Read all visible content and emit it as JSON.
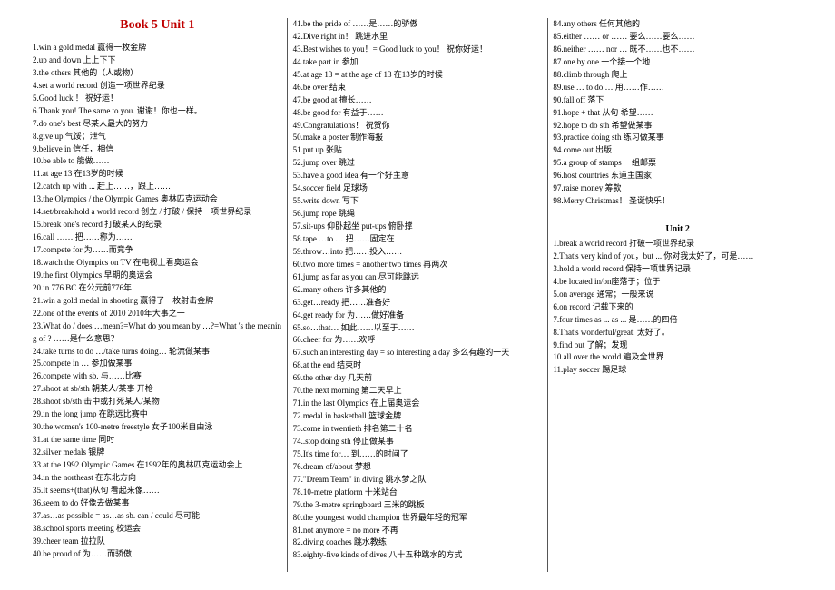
{
  "title": "Book 5   Unit 1",
  "subtitle": "Unit 2",
  "u1": [
    "1.win a gold medal     赢得一枚金牌",
    "2.up and down       上上下下",
    "3.the others             其他的（人或物）",
    "4.set a world record     创造一项世界纪录",
    "5.Good luck ！          祝好运！",
    "6.Thank you! The same to you.  谢谢！你也一样。",
    "7.do one's best       尽某人最大的努力",
    "8.give up         气馁；泄气",
    "9.believe in         信任，相信",
    "10.be able to       能做……",
    "11.at age 13       在13岁的时候",
    "12.catch up with ...    赶上……，跟上……",
    "13.the Olympics / the Olympic Games  奥林匹克运动会",
    "14.set/break/hold a world record 创立 / 打破 / 保持一项世界纪录",
    "15.break one's record 打破某人的纪录",
    "16.call ……  把……称为……",
    "17.compete for   为……而竞争",
    "18.watch the Olympics on TV  在电视上看奥运会",
    "19.the first Olympics  早期的奥运会",
    "20.in 776 BC    在公元前776年",
    "21.win a gold medal in shooting  赢得了一枚射击金牌",
    "22.one of the events of 2010  2010年大事之一",
    "23.What do / does …mean?=What do you mean by …?=What 's the meaning of ?  ……是什么意思？",
    "24.take turns to do …/take turns doing…   轮流做某事",
    "25.compete in …  参加做某事",
    "26.compete with sb.  与……比赛",
    "27.shoot at sb/sth  朝某人/某事 开枪",
    "28.shoot sb/sth  击中或打死某人/某物",
    "29.in the long jump  在跳远比赛中",
    "30.the women's 100-metre freestyle   女子100米自由泳",
    "31.at the same time  同时",
    "32.silver medals 银牌",
    "33.at the 1992 Olympic Games   在1992年的奥林匹克运动会上",
    "34.in the northeast   在东北方向",
    "35.It seems+(that)从句  看起来像……",
    "36.seem to do  好像去做某事",
    "37.as…as possible = as…as sb. can / could  尽可能",
    "38.school sports meeting  校运会",
    "39.cheer team 拉拉队",
    "40.be proud of  为……而骄傲",
    "41.be the pride of   ……是……的骄傲",
    "42.Dive right in！ 跳进水里",
    "43.Best wishes to you！= Good luck to you！ 祝你好运！",
    "44.take part in  参加",
    "45.at age 13 = at the age of 13   在13岁的时候",
    "46.be over  结束",
    "47.be good at   擅长……",
    "48.be good for  有益于……",
    "49.Congratulations！ 祝贺你",
    "50.make a poster 制作海报",
    "51.put up  张贴",
    "52.jump over  跳过",
    "53.have a good idea   有一个好主意",
    "54.soccer field   足球场",
    "55.write down  写下",
    "56.jump rope 跳绳",
    "57.sit-ups 仰卧起坐 put-ups  俯卧撑",
    "58.tape …to …  把……固定在",
    "59.throw…into  把……投入……",
    "60.two more times = another two times   再两次",
    "61.jump as far as you can  尽可能跳远",
    "62.many others 许多其他的",
    "63.get…ready 把……准备好",
    "64.get ready for   为……做好准备",
    "65.so…that…  如此……以至于……",
    "66.cheer for  为……欢呼",
    "67.such an interesting day = so interesting a day  多么有趣的一天",
    "68.at the end   结束时",
    "69.the other day  几天前",
    "70.the next morning   第二天早上",
    "71.in the last Olympics   在上届奥运会",
    "72.medal in basketball   篮球金牌",
    "73.come in twentieth    排名第二十名",
    "74..stop doing sth  停止做某事",
    "75.It's time for…  到……的时间了",
    "76.dream of/about  梦想",
    "77.\"Dream Team\" in diving   跳水梦之队",
    "78.10-metre platform  十米站台",
    "79.the 3-metre springboard    三米的跳板",
    "80.the youngest world champion 世界最年轻的冠军",
    "81.not anymore = no more  不再",
    "82.diving coaches   跳水教练",
    "83.eighty-five kinds of dives    八十五种跳水的方式",
    "84.any others  任何其他的",
    "85.either ……  or ……  要么……要么……",
    "86.neither ……  nor …   既不……也不……",
    "87.one by one  一个接一个地",
    "88.climb through   爬上",
    "89.use … to do …    用……作……",
    "90.fall off   落下",
    "91.hope + that 从句   希望……",
    "92.hope to do sth  希望做某事",
    "93.practice doing sth   练习做某事",
    "94.come out  出版",
    "95.a group of stamps 一组邮票",
    "96.host countries  东道主国家",
    "97.raise money  筹款",
    "98.Merry Christmas！   圣诞快乐！"
  ],
  "u2": [
    "1.break a world record 打破一项世界纪录",
    "2.That's very kind of you，but ... 你对我太好了，可是……",
    "3.hold a world record 保持一项世界记录",
    "4.be located in/on座落于；位于",
    "5.on average 通常；一般来说",
    "6.on record 记载下来的",
    "7.four times as ... as ... 是……的四倍",
    "8.That's wonderful/great. 太好了。",
    "9.find out 了解；发现",
    "10.all over the world 遍及全世界",
    "11.play soccer    踢足球"
  ]
}
